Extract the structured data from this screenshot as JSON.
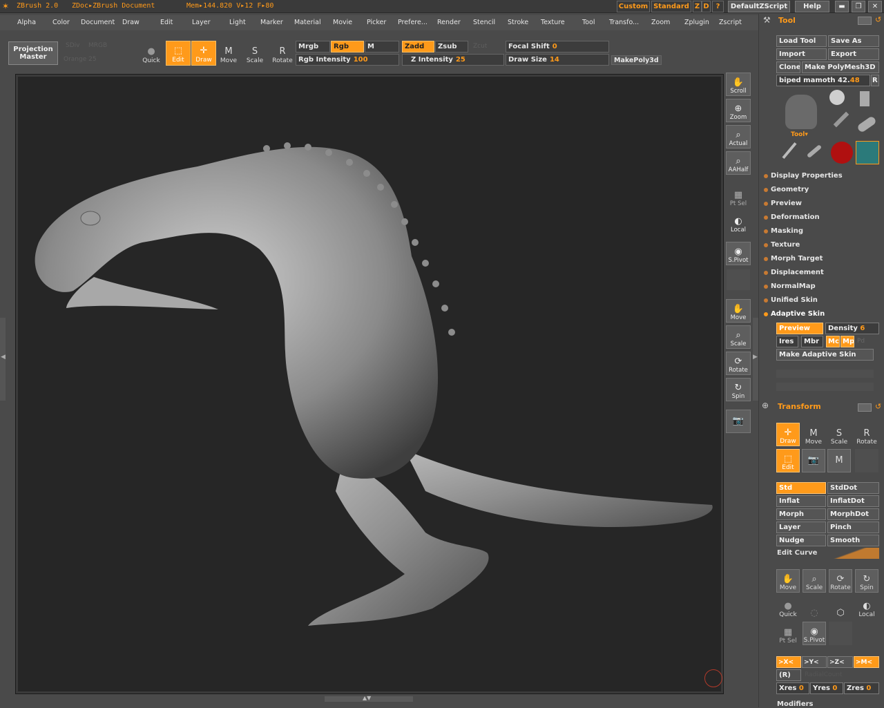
{
  "titlebar": {
    "app": "ZBrush 2.0",
    "doc": "ZDoc▸ZBrush Document",
    "mem": "Mem▸144.820  V▸12  F▸80",
    "buttons": [
      "Custom",
      "Standard",
      "Z",
      "D",
      "?",
      "DefaultZScript",
      "Help"
    ]
  },
  "menubar": [
    "Alpha",
    "Color",
    "Document",
    "Draw",
    "Edit",
    "Layer",
    "Light",
    "Marker",
    "Material",
    "Movie",
    "Picker",
    "Prefere...",
    "Render",
    "Stencil",
    "Stroke",
    "Texture",
    "Tool",
    "Transfo...",
    "Zoom",
    "Zplugin",
    "Zscript"
  ],
  "toolrow": {
    "projection_master": "Projection Master",
    "ghost_1": "SDiv",
    "ghost_2": "MRGB",
    "ghost_3": "Orange 25",
    "buttons": [
      "Quick",
      "Edit",
      "Draw",
      "Move",
      "Scale",
      "Rotate"
    ],
    "mrgb": "Mrgb",
    "rgb": "Rgb",
    "m": "M",
    "zadd": "Zadd",
    "zsub": "Zsub",
    "zcut": "Zcut",
    "rgb_intensity_label": "Rgb Intensity",
    "rgb_intensity_value": "100",
    "z_intensity_label": "Z Intensity",
    "z_intensity_value": "25",
    "focal_shift_label": "Focal Shift",
    "focal_shift_value": "0",
    "draw_size_label": "Draw Size",
    "draw_size_value": "14",
    "makepoly3d": "MakePoly3d"
  },
  "shelf": [
    "Scroll",
    "Zoom",
    "Actual",
    "AAHalf",
    "Pt Sel",
    "Local",
    "S.Pivot",
    "Move",
    "Scale",
    "Rotate",
    "Spin"
  ],
  "panel": {
    "tool_header": "Tool",
    "load_tool": "Load Tool",
    "save_as": "Save As",
    "import": "Import",
    "export": "Export",
    "clone": "Clone",
    "make_polymesh": "Make PolyMesh3D",
    "tool_name": "biped mamoth",
    "tool_name_value": "42.",
    "tool_name_value2": "48",
    "r_btn": "R",
    "tool_label": "Tool▾",
    "sections": [
      "Display Properties",
      "Geometry",
      "Preview",
      "Deformation",
      "Masking",
      "Texture",
      "Morph Target",
      "Displacement",
      "NormalMap",
      "Unified Skin",
      "Adaptive Skin"
    ],
    "adaptive": {
      "preview": "Preview",
      "density_label": "Density",
      "density_value": "6",
      "ires": "Ires",
      "mbr": "Mbr",
      "mc": "Mc",
      "mp": "Mp",
      "pd": "Pd",
      "make_adaptive": "Make Adaptive Skin"
    },
    "transform_header": "Transform",
    "transform_tools": [
      "Draw",
      "Move",
      "Scale",
      "Rotate",
      "Edit"
    ],
    "brushes": [
      [
        "Std",
        "StdDot"
      ],
      [
        "Inflat",
        "InflatDot"
      ],
      [
        "Morph",
        "MorphDot"
      ],
      [
        "Layer",
        "Pinch"
      ],
      [
        "Nudge",
        "Smooth"
      ]
    ],
    "edit_curve": "Edit Curve",
    "nav_tools": [
      "Move",
      "Scale",
      "Rotate",
      "Spin"
    ],
    "misc_tools": [
      "Quick",
      "Local",
      "Pt Sel",
      "S.Pivot"
    ],
    "symmetry": [
      ">X<",
      ">Y<",
      ">Z<",
      ">M<"
    ],
    "r_sym": "(R)",
    "radial": "RadialCount",
    "xres_label": "Xres",
    "xres_value": "0",
    "yres_label": "Yres",
    "yres_value": "0",
    "zres_label": "Zres",
    "zres_value": "0",
    "modifiers": "Modifiers"
  },
  "colors": {
    "accent": "#ff9a1a",
    "canvas": "#262626",
    "ui": "#4a4a4a"
  }
}
